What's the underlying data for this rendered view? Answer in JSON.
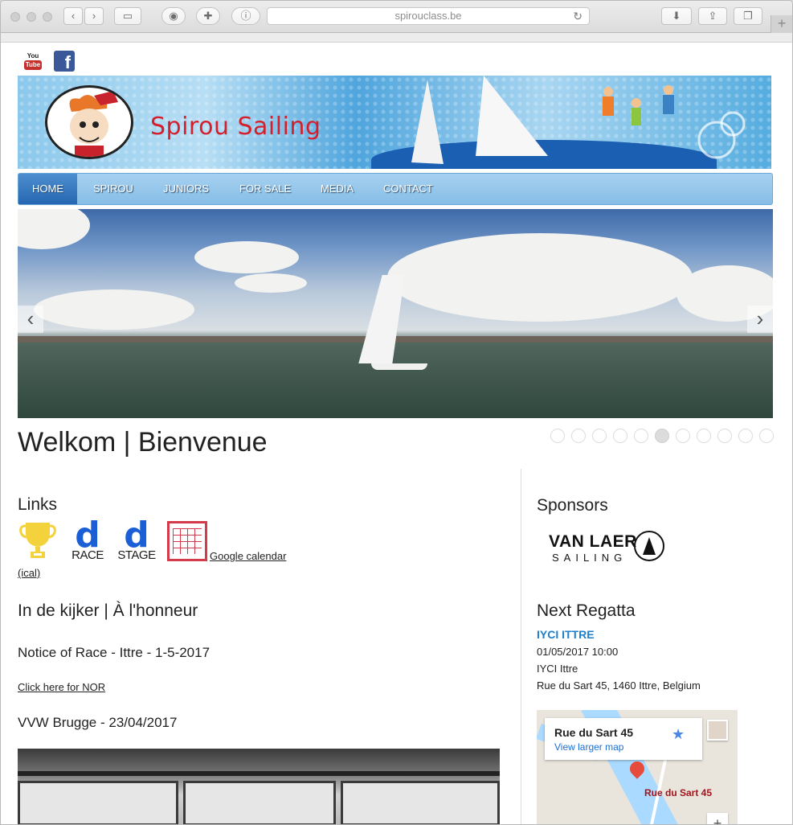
{
  "browser": {
    "url": "spirouclass.be",
    "reload_icon": "↻",
    "newtab_label": "+"
  },
  "social": {
    "youtube": {
      "top": "You",
      "bottom": "Tube"
    },
    "facebook": {
      "letter": "f"
    }
  },
  "header": {
    "brand": "Spirou Sailing"
  },
  "nav": {
    "items": [
      {
        "label": "HOME",
        "active": true
      },
      {
        "label": "SPIROU"
      },
      {
        "label": "JUNIORS"
      },
      {
        "label": "FOR SALE"
      },
      {
        "label": "MEDIA"
      },
      {
        "label": "CONTACT"
      }
    ]
  },
  "slider": {
    "prev_arrow": "‹",
    "next_arrow": "›",
    "total_slides": 11,
    "active_slide": 6
  },
  "main": {
    "title": "Welkom | Bienvenue",
    "links_heading": "Links",
    "links": {
      "race_d": "d",
      "race_label": "RACE",
      "stage_d": "d",
      "stage_label": "STAGE",
      "google_calendar": "Google calendar",
      "ical": "(ical)"
    },
    "spotlight_heading": "In de kijker | À l'honneur",
    "news": [
      {
        "title": "Notice of Race - Ittre - 1-5-2017"
      },
      {
        "link": "Click here for NOR"
      },
      {
        "title": "VVW Brugge - 23/04/2017"
      }
    ]
  },
  "sidebar": {
    "sponsors_heading": "Sponsors",
    "sponsor": {
      "name": "VAN LAER",
      "tagline": "SAILING"
    },
    "next_regatta_heading": "Next Regatta",
    "regatta": {
      "name": "IYCI ITTRE",
      "datetime": "01/05/2017 10:00",
      "club": "IYCI Ittre",
      "address": "Rue du Sart 45, 1460 Ittre, Belgium"
    },
    "map": {
      "card_title": "Rue du Sart 45",
      "card_link": "View larger map",
      "star": "★",
      "pin_label": "Rue du Sart 45",
      "zoom": "+"
    }
  }
}
